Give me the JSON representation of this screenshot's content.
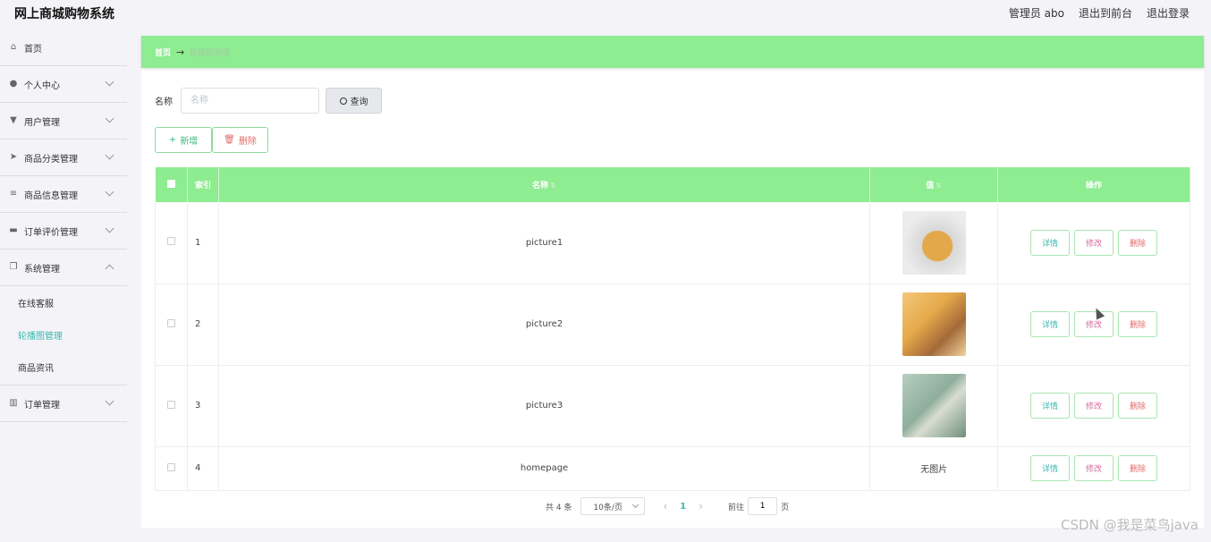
{
  "header": {
    "app_title": "网上商城购物系统",
    "admin_label": "管理员 abo",
    "exit_front": "退出到前台",
    "logout": "退出登录"
  },
  "sidebar": {
    "items": [
      {
        "label": "首页",
        "icon": "home-icon"
      },
      {
        "label": "个人中心",
        "icon": "user-icon"
      },
      {
        "label": "用户管理",
        "icon": "users-icon"
      },
      {
        "label": "商品分类管理",
        "icon": "send-icon"
      },
      {
        "label": "商品信息管理",
        "icon": "list-icon"
      },
      {
        "label": "订单评价管理",
        "icon": "monitor-icon"
      },
      {
        "label": "系统管理",
        "icon": "copy-icon"
      },
      {
        "label": "订单管理",
        "icon": "chart-icon"
      }
    ],
    "system_sub": [
      {
        "label": "在线客服"
      },
      {
        "label": "轮播图管理"
      },
      {
        "label": "商品资讯"
      }
    ]
  },
  "breadcrumb": {
    "home": "首页",
    "arrow": "→",
    "current": "轮播图管理"
  },
  "search": {
    "label": "名称",
    "placeholder": "名称",
    "button": "查询"
  },
  "actions": {
    "add": "新增",
    "delete": "删除"
  },
  "table": {
    "columns": [
      "索引",
      "名称",
      "值",
      "操作"
    ],
    "rows": [
      {
        "index": "1",
        "name": "picture1",
        "value": "image"
      },
      {
        "index": "2",
        "name": "picture2",
        "value": "image"
      },
      {
        "index": "3",
        "name": "picture3",
        "value": "image"
      },
      {
        "index": "4",
        "name": "homepage",
        "value": "无图片"
      }
    ],
    "op_detail": "详情",
    "op_edit": "修改",
    "op_delete": "删除"
  },
  "pager": {
    "total": "共 4 条",
    "size": "10条/页",
    "prev": "‹",
    "current": "1",
    "next": "›",
    "goto_prefix": "前往",
    "goto_value": "1",
    "goto_suffix": "页"
  },
  "watermark": "CSDN @我是菜鸟java",
  "colors": {
    "accent_green": "#8eec91",
    "teal": "#3ab8b0",
    "danger": "#e26a6a"
  }
}
